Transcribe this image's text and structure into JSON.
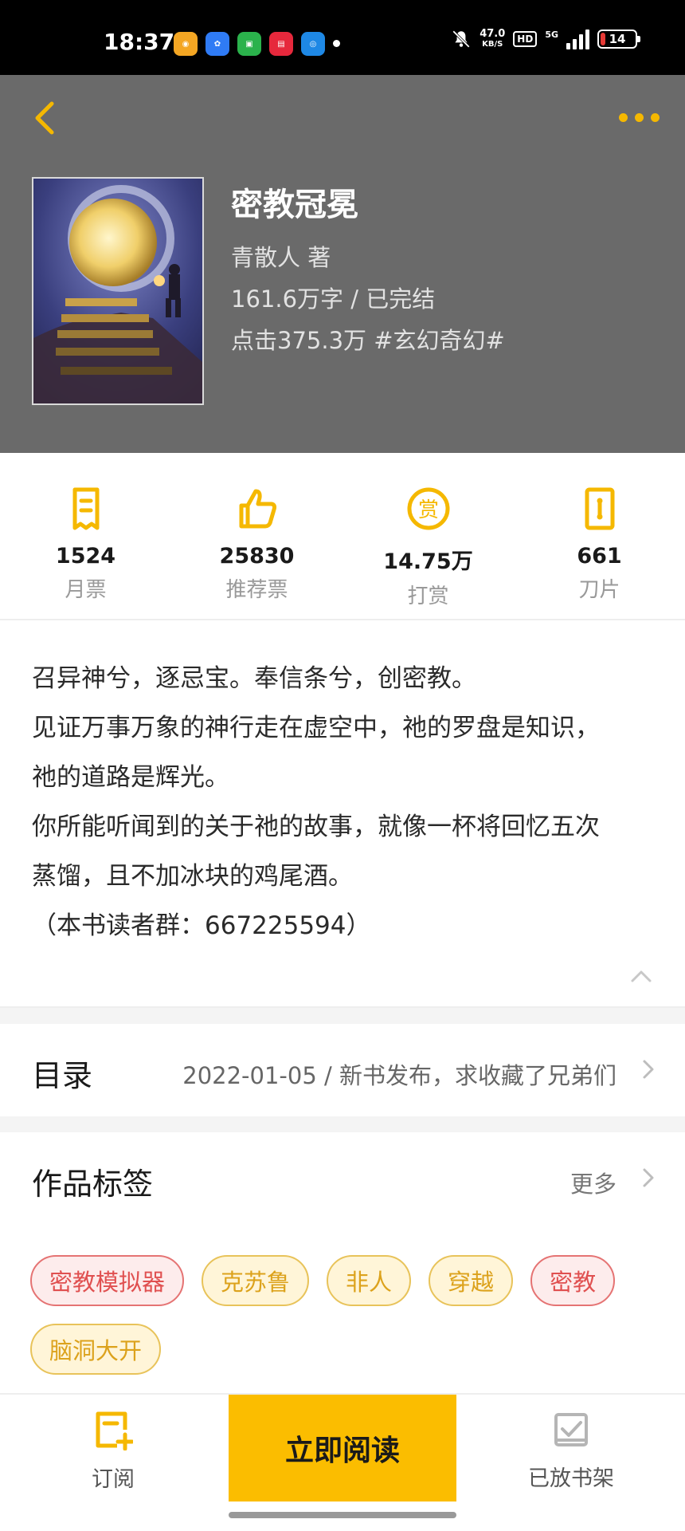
{
  "status_bar": {
    "time": "18:37",
    "net_speed_value": "47.0",
    "net_speed_unit": "KB/S",
    "hd": "HD",
    "signal": "5G",
    "battery": "14"
  },
  "book": {
    "title": "密教冠冕",
    "author_line": "青散人  著",
    "words_status": "161.6万字 / 已完结",
    "clicks_genre": "点击375.3万  #玄幻奇幻#"
  },
  "stats": [
    {
      "icon": "monthly-ticket-icon",
      "value": "1524",
      "label": "月票"
    },
    {
      "icon": "thumbs-up-icon",
      "value": "25830",
      "label": "推荐票"
    },
    {
      "icon": "reward-coin-icon",
      "value": "14.75万",
      "label": "打赏"
    },
    {
      "icon": "blade-icon",
      "value": "661",
      "label": "刀片"
    }
  ],
  "synopsis": [
    "召异神兮，逐忌宝。奉信条兮，创密教。",
    "见证万事万象的神行走在虚空中，祂的罗盘是知识，",
    "祂的道路是辉光。",
    "你所能听闻到的关于祂的故事，就像一杯将回忆五次",
    "蒸馏，且不加冰块的鸡尾酒。",
    "（本书读者群：667225594）"
  ],
  "catalog": {
    "title": "目录",
    "latest": "2022-01-05 / 新书发布，求收藏了兄弟们"
  },
  "tags_section": {
    "title": "作品标签",
    "more": "更多",
    "tags": [
      {
        "label": "密教模拟器",
        "style": "red"
      },
      {
        "label": "克苏鲁",
        "style": "yellow"
      },
      {
        "label": "非人",
        "style": "yellow"
      },
      {
        "label": "穿越",
        "style": "yellow"
      },
      {
        "label": "密教",
        "style": "red"
      },
      {
        "label": "脑洞大开",
        "style": "yellow"
      }
    ]
  },
  "bottom_bar": {
    "subscribe": "订阅",
    "read_now": "立即阅读",
    "on_shelf": "已放书架"
  },
  "colors": {
    "accent": "#fbbd00",
    "header_bg": "#6a6a6a"
  }
}
